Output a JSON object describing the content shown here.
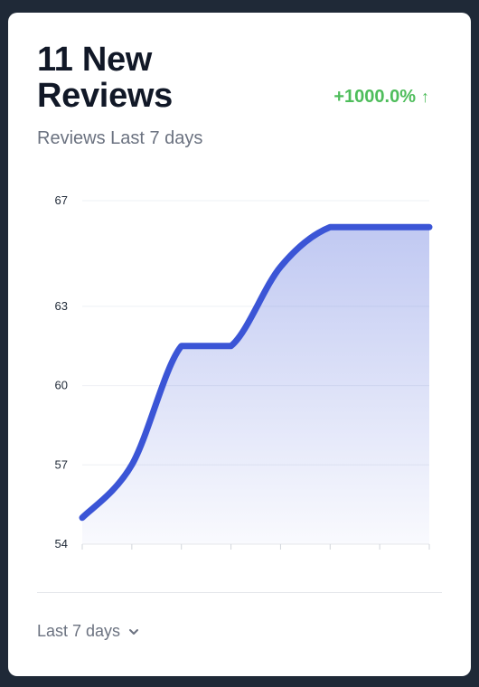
{
  "card": {
    "title": "11 New Reviews",
    "change": "+1000.0%",
    "subtitle": "Reviews Last 7 days",
    "footer_label": "Last 7 days"
  },
  "colors": {
    "line": "#3b55d6",
    "positive": "#4ebd5b"
  },
  "chart_data": {
    "type": "area",
    "title": "",
    "xlabel": "",
    "ylabel": "",
    "x": [
      1,
      2,
      3,
      4,
      5,
      6,
      7,
      8
    ],
    "values": [
      55,
      57,
      61.5,
      61.5,
      64.5,
      66,
      66,
      66
    ],
    "ylim": [
      54,
      67
    ],
    "yticks": [
      54,
      57,
      60,
      63,
      67
    ],
    "grid": true
  }
}
